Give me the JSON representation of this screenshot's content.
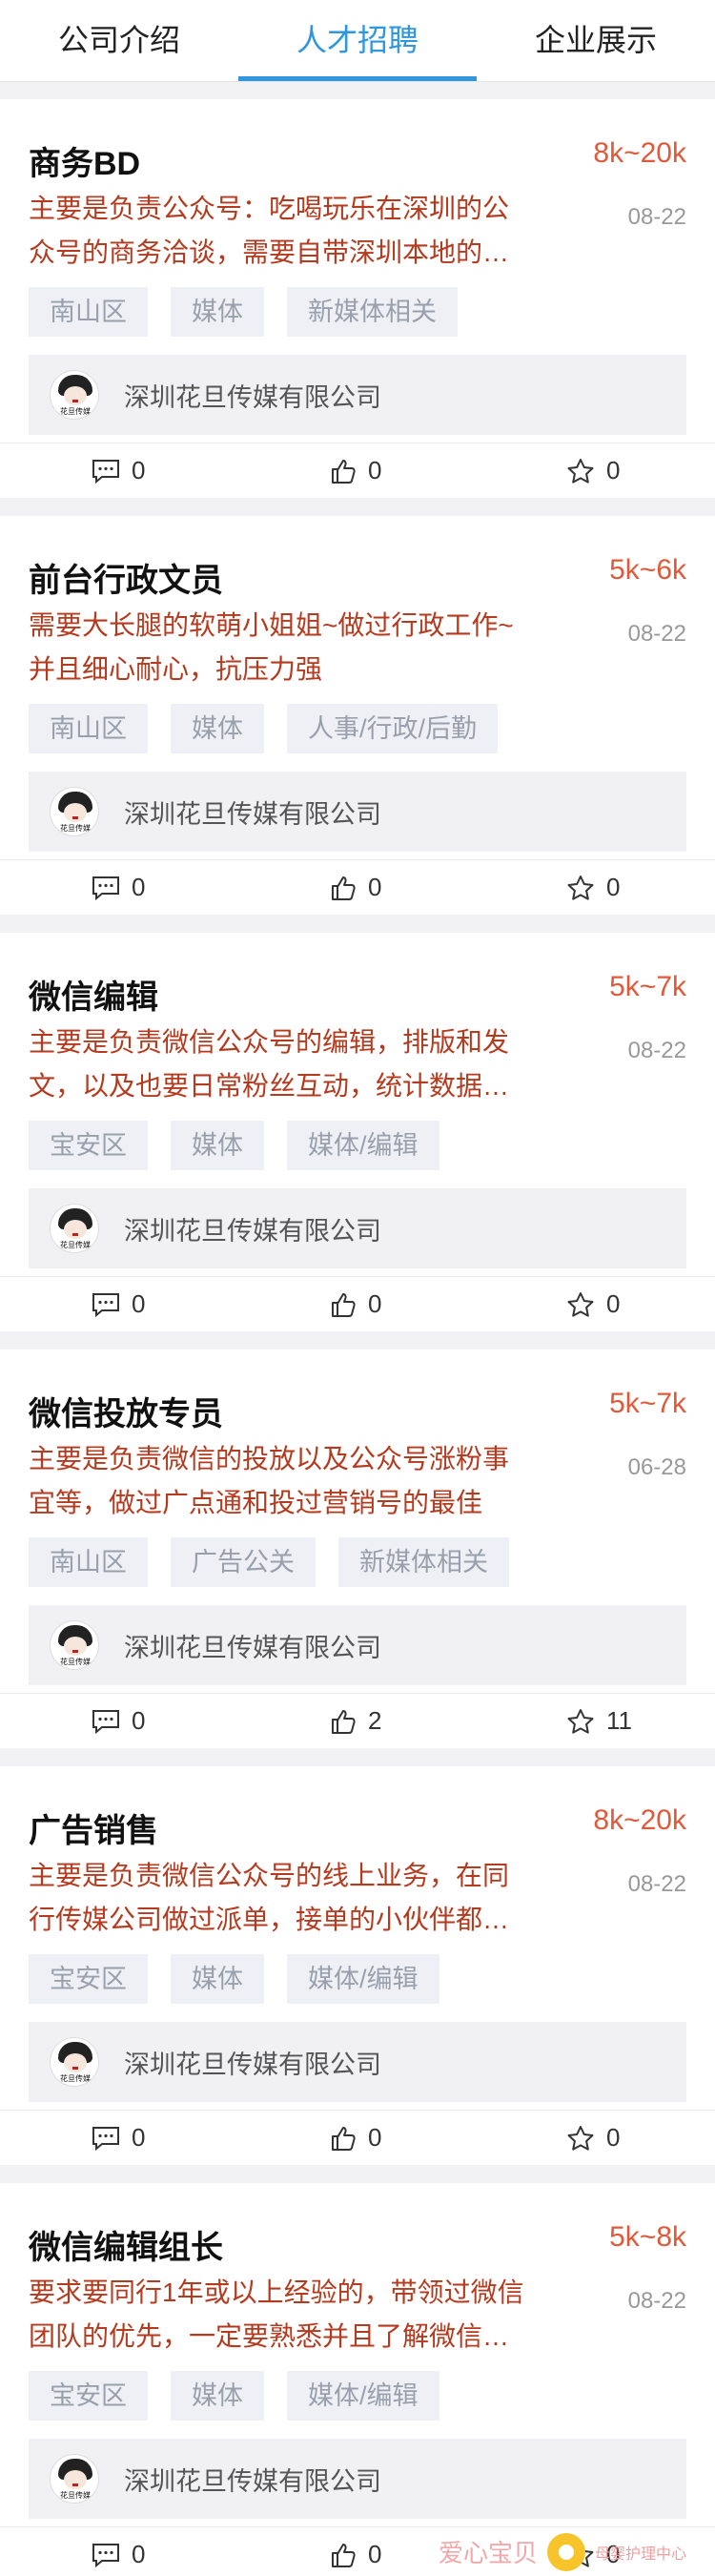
{
  "tabs": [
    {
      "label": "公司介绍",
      "active": false
    },
    {
      "label": "人才招聘",
      "active": true
    },
    {
      "label": "企业展示",
      "active": false
    }
  ],
  "colors": {
    "accent": "#2f96e0",
    "salary": "#e05a3a",
    "description": "#b53a1e"
  },
  "jobs": [
    {
      "title": "商务BD",
      "salary": "8k~20k",
      "date": "08-22",
      "description": "主要是负责公众号：吃喝玩乐在深圳的公众号的商务洽谈，需要自带深圳本地的…",
      "tags": [
        "南山区",
        "媒体",
        "新媒体相关"
      ],
      "company": "深圳花旦传媒有限公司",
      "logo_text": "花旦传媒",
      "comments": "0",
      "likes": "0",
      "favorites": "0"
    },
    {
      "title": "前台行政文员",
      "salary": "5k~6k",
      "date": "08-22",
      "description": "需要大长腿的软萌小姐姐~做过行政工作~并且细心耐心，抗压力强",
      "tags": [
        "南山区",
        "媒体",
        "人事/行政/后勤"
      ],
      "company": "深圳花旦传媒有限公司",
      "logo_text": "花旦传媒",
      "comments": "0",
      "likes": "0",
      "favorites": "0"
    },
    {
      "title": "微信编辑",
      "salary": "5k~7k",
      "date": "08-22",
      "description": "主要是负责微信公众号的编辑，排版和发文，以及也要日常粉丝互动，统计数据…",
      "tags": [
        "宝安区",
        "媒体",
        "媒体/编辑"
      ],
      "company": "深圳花旦传媒有限公司",
      "logo_text": "花旦传媒",
      "comments": "0",
      "likes": "0",
      "favorites": "0"
    },
    {
      "title": "微信投放专员",
      "salary": "5k~7k",
      "date": "06-28",
      "description": "主要是负责微信的投放以及公众号涨粉事宜等，做过广点通和投过营销号的最佳",
      "tags": [
        "南山区",
        "广告公关",
        "新媒体相关"
      ],
      "company": "深圳花旦传媒有限公司",
      "logo_text": "花旦传媒",
      "comments": "0",
      "likes": "2",
      "favorites": "11"
    },
    {
      "title": "广告销售",
      "salary": "8k~20k",
      "date": "08-22",
      "description": "主要是负责微信公众号的线上业务，在同行传媒公司做过派单，接单的小伙伴都…",
      "tags": [
        "宝安区",
        "媒体",
        "媒体/编辑"
      ],
      "company": "深圳花旦传媒有限公司",
      "logo_text": "花旦传媒",
      "comments": "0",
      "likes": "0",
      "favorites": "0"
    },
    {
      "title": "微信编辑组长",
      "salary": "5k~8k",
      "date": "08-22",
      "description": "要求要同行1年或以上经验的，带领过微信团队的优先，一定要熟悉并且了解微信…",
      "tags": [
        "宝安区",
        "媒体",
        "媒体/编辑"
      ],
      "company": "深圳花旦传媒有限公司",
      "logo_text": "花旦传媒",
      "comments": "0",
      "likes": "0",
      "favorites": "0"
    }
  ],
  "watermark": {
    "title": "爱心宝贝",
    "subtitle": "母婴护理中心"
  }
}
